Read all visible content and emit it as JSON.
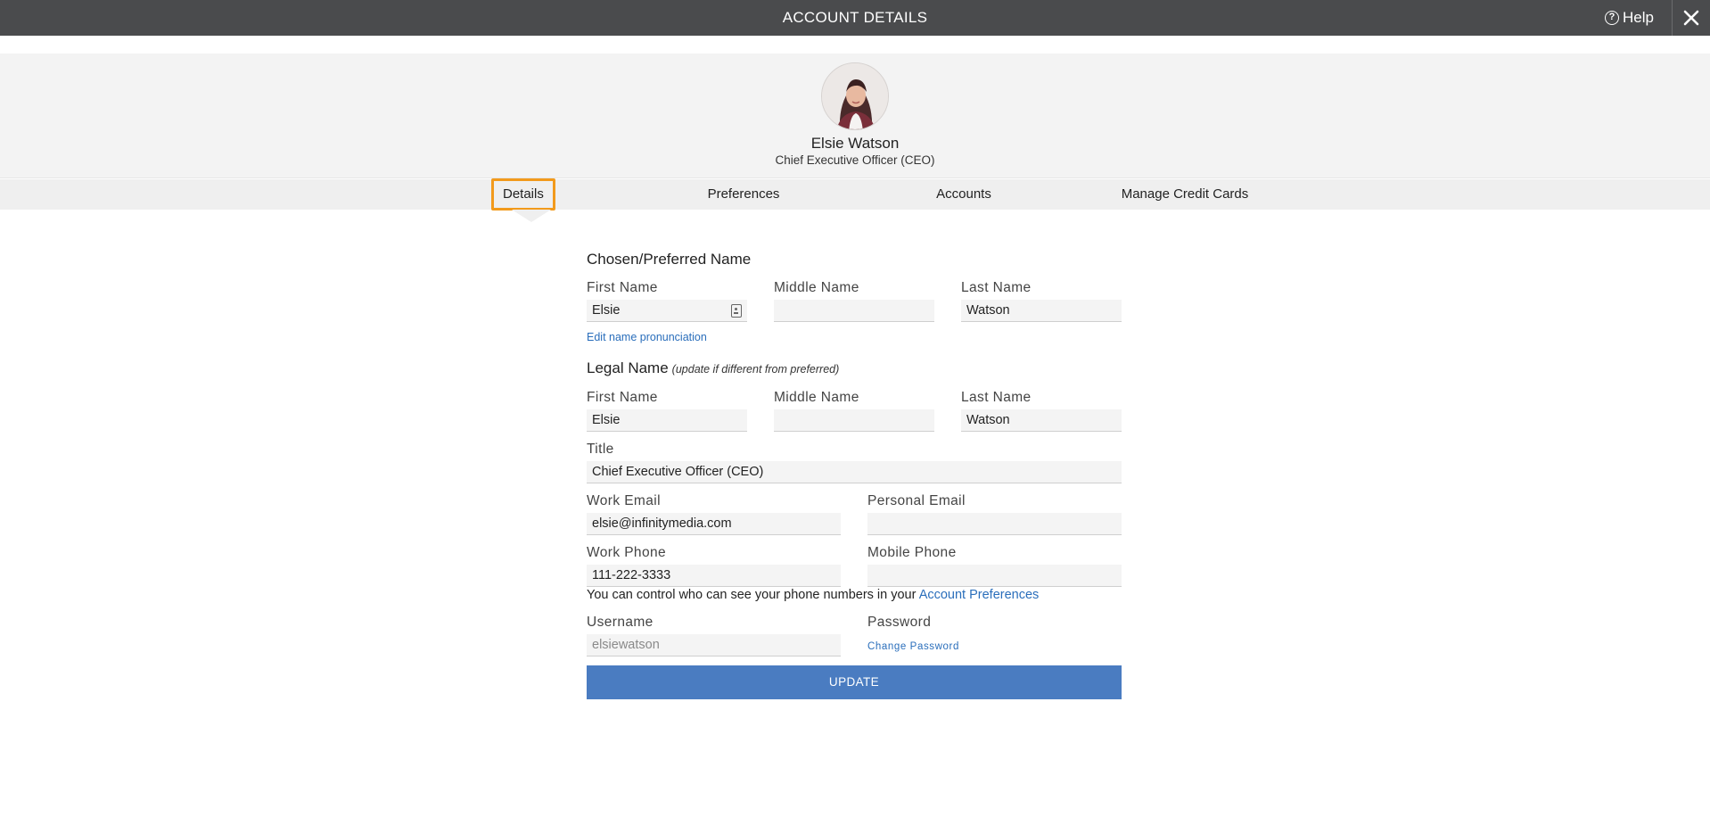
{
  "header": {
    "title": "ACCOUNT DETAILS",
    "help_label": "Help"
  },
  "profile": {
    "name": "Elsie Watson",
    "role": "Chief Executive Officer (CEO)"
  },
  "tabs": [
    {
      "label": "Details",
      "active": true
    },
    {
      "label": "Preferences",
      "active": false
    },
    {
      "label": "Accounts",
      "active": false
    },
    {
      "label": "Manage Credit Cards",
      "active": false
    }
  ],
  "form": {
    "preferred": {
      "heading": "Chosen/Preferred Name",
      "first_label": "First Name",
      "first_value": "Elsie",
      "middle_label": "Middle Name",
      "middle_value": "",
      "last_label": "Last Name",
      "last_value": "Watson",
      "pronunciation_link": "Edit name pronunciation"
    },
    "legal": {
      "heading": "Legal Name",
      "note": "(update if different from preferred)",
      "first_label": "First Name",
      "first_value": "Elsie",
      "middle_label": "Middle Name",
      "middle_value": "",
      "last_label": "Last Name",
      "last_value": "Watson"
    },
    "title": {
      "label": "Title",
      "value": "Chief Executive Officer (CEO)"
    },
    "work_email": {
      "label": "Work Email",
      "value": "elsie@infinitymedia.com"
    },
    "personal_email": {
      "label": "Personal Email",
      "value": ""
    },
    "work_phone": {
      "label": "Work Phone",
      "value": "111-222-3333"
    },
    "mobile_phone": {
      "label": "Mobile Phone",
      "value": ""
    },
    "phone_helper": "You can control who can see your phone numbers in your",
    "phone_helper_link": "Account Preferences",
    "username": {
      "label": "Username",
      "value": "elsiewatson"
    },
    "password": {
      "label": "Password",
      "link": "Change Password"
    },
    "update_button": "UPDATE"
  },
  "colors": {
    "topbar": "#4a4b4d",
    "accent_tab": "#f29a1c",
    "primary_button": "#4a7cc1",
    "link": "#2a6ebb"
  },
  "icons": {
    "help": "question-circle-icon",
    "close": "close-icon",
    "pronunciation": "contact-card-icon"
  }
}
